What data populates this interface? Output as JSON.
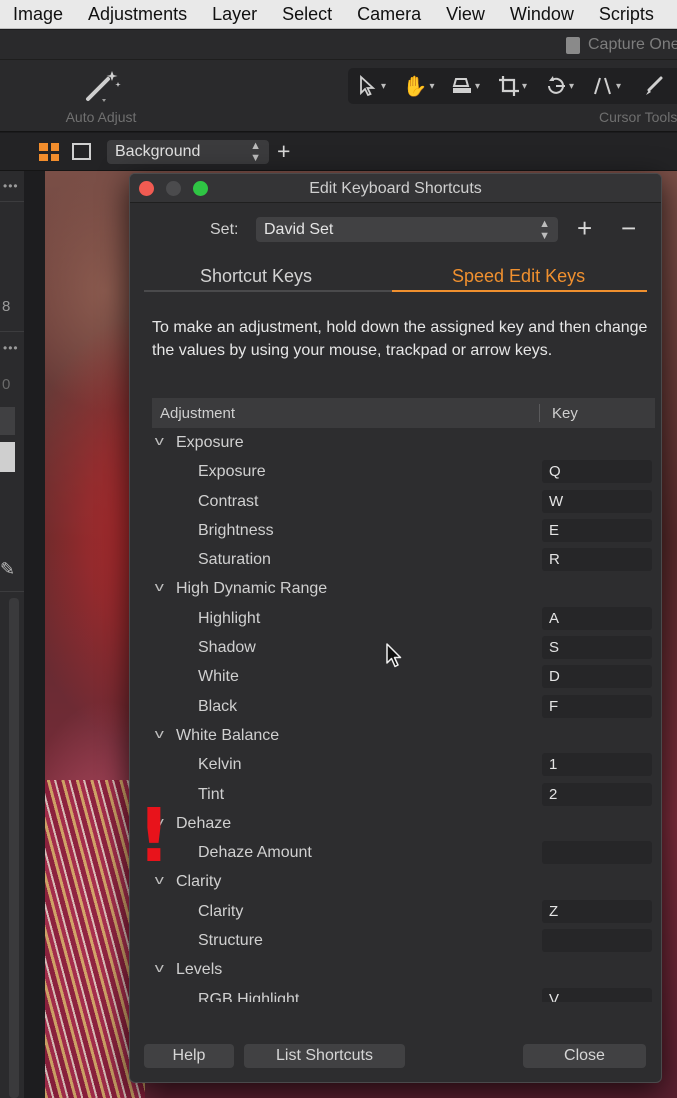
{
  "menubar": {
    "items": [
      "Image",
      "Adjustments",
      "Layer",
      "Select",
      "Camera",
      "View",
      "Window",
      "Scripts"
    ]
  },
  "window": {
    "doc_title": "Capture One"
  },
  "toolbar": {
    "auto_adjust_label": "Auto Adjust",
    "cursor_tools_label": "Cursor Tools",
    "accent_color": "#f28d2c"
  },
  "viewer": {
    "variant_value": "Background"
  },
  "left_panel": {
    "number_8": "8",
    "number_0": "0"
  },
  "dialog": {
    "title": "Edit Keyboard Shortcuts",
    "set_label": "Set:",
    "set_value": "David Set",
    "add_symbol": "+",
    "remove_symbol": "−",
    "tabs": [
      {
        "label": "Shortcut Keys",
        "active": false
      },
      {
        "label": "Speed Edit Keys",
        "active": true
      }
    ],
    "description": "To make an adjustment, hold down the assigned key and then change the values by using your mouse, trackpad or arrow keys.",
    "table": {
      "headers": {
        "adjustment": "Adjustment",
        "key": "Key"
      },
      "rows": [
        {
          "type": "group",
          "label": "Exposure"
        },
        {
          "type": "item",
          "label": "Exposure",
          "key": "Q"
        },
        {
          "type": "item",
          "label": "Contrast",
          "key": "W"
        },
        {
          "type": "item",
          "label": "Brightness",
          "key": "E"
        },
        {
          "type": "item",
          "label": "Saturation",
          "key": "R"
        },
        {
          "type": "group",
          "label": "High Dynamic Range"
        },
        {
          "type": "item",
          "label": "Highlight",
          "key": "A"
        },
        {
          "type": "item",
          "label": "Shadow",
          "key": "S"
        },
        {
          "type": "item",
          "label": "White",
          "key": "D"
        },
        {
          "type": "item",
          "label": "Black",
          "key": "F"
        },
        {
          "type": "group",
          "label": "White Balance"
        },
        {
          "type": "item",
          "label": "Kelvin",
          "key": "1"
        },
        {
          "type": "item",
          "label": "Tint",
          "key": "2"
        },
        {
          "type": "group",
          "label": "Dehaze"
        },
        {
          "type": "item",
          "label": "Dehaze Amount",
          "key": ""
        },
        {
          "type": "group",
          "label": "Clarity"
        },
        {
          "type": "item",
          "label": "Clarity",
          "key": "Z"
        },
        {
          "type": "item",
          "label": "Structure",
          "key": ""
        },
        {
          "type": "group",
          "label": "Levels"
        },
        {
          "type": "item",
          "label": "RGB Highlight",
          "key": "V"
        }
      ]
    },
    "buttons": {
      "help": "Help",
      "list_shortcuts": "List Shortcuts",
      "close": "Close"
    },
    "tab_accent_color": "#f0902f"
  },
  "annotation": {
    "exclamation": "!",
    "color": "#e8131b"
  }
}
